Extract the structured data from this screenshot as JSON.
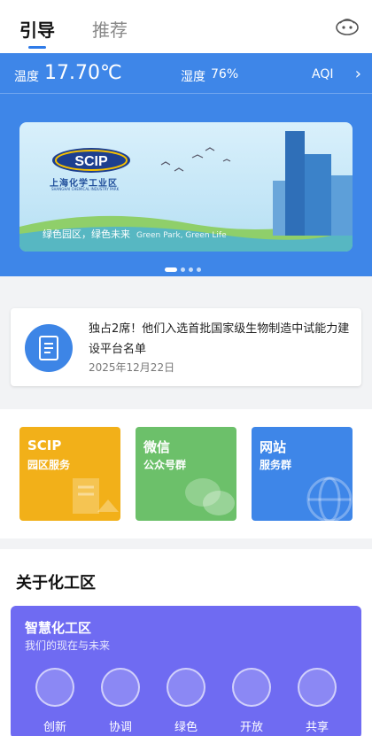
{
  "tabs": {
    "active": "引导",
    "inactive": "推荐"
  },
  "weather": {
    "temp_label": "温度",
    "temp_value": "17.70℃",
    "humidity_label": "湿度",
    "humidity_value": "76%",
    "aqi_label": "AQI"
  },
  "banner": {
    "logo_text": "SCIP",
    "park_name": "上海化学工业区",
    "park_name_en": "SHANGHAI CHEMICAL INDUSTRY PARK",
    "slogan": "绿色园区，绿色未来",
    "slogan_en": "Green Park, Green Life",
    "slide_count": 4,
    "active_slide": 1
  },
  "news": {
    "title": "独占2席！他们入选首批国家级生物制造中试能力建设平台名单",
    "date": "2025年12月22日"
  },
  "services": [
    {
      "title": "SCIP",
      "subtitle": "园区服务",
      "color": "#f2b019"
    },
    {
      "title": "微信",
      "subtitle": "公众号群",
      "color": "#6cc06a"
    },
    {
      "title": "网站",
      "subtitle": "服务群",
      "color": "#3e86e8"
    }
  ],
  "about": {
    "title": "关于化工区",
    "card_title": "智慧化工区",
    "card_subtitle": "我们的现在与未来",
    "features": [
      "创新",
      "协调",
      "绿色",
      "开放",
      "共享"
    ]
  },
  "colors": {
    "brand_blue": "#3e86e8",
    "purple_card": "#6f6bf2"
  }
}
